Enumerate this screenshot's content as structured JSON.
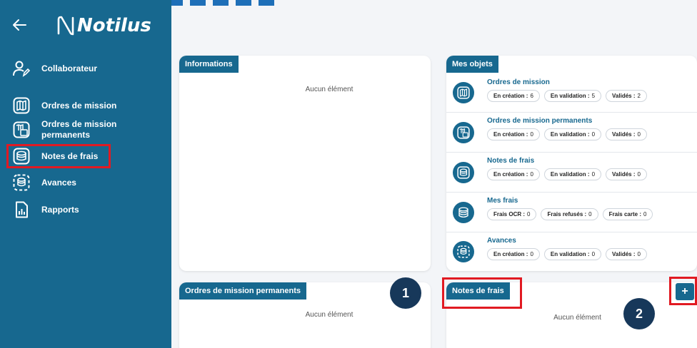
{
  "app": {
    "logo_text": "Notilus",
    "logo_symbol": "N"
  },
  "sidebar": {
    "back_icon": "arrow-left-icon",
    "items": [
      {
        "label": "Collaborateur",
        "icon": "user-edit-icon"
      },
      {
        "label": "Ordres de mission",
        "icon": "map-icon"
      },
      {
        "label": "Ordres de mission\npermanents",
        "icon": "map-calendar-icon"
      },
      {
        "label": "Notes de frais",
        "icon": "coins-icon"
      },
      {
        "label": "Avances",
        "icon": "coins-dashed-icon"
      },
      {
        "label": "Rapports",
        "icon": "report-chart-icon"
      }
    ]
  },
  "cards": {
    "informations": {
      "title": "Informations",
      "empty": "Aucun élément"
    },
    "ordres_permanents": {
      "title": "Ordres de mission permanents",
      "empty": "Aucun élément"
    },
    "notes_de_frais": {
      "title": "Notes de frais",
      "empty": "Aucun élément",
      "add_label": "+"
    }
  },
  "mes_objets": {
    "title": "Mes objets",
    "rows": [
      {
        "title": "Ordres de mission",
        "icon": "map-icon",
        "pills": [
          {
            "label": "En création :",
            "value": "6"
          },
          {
            "label": "En validation :",
            "value": "5"
          },
          {
            "label": "Validés :",
            "value": "2"
          }
        ]
      },
      {
        "title": "Ordres de mission permanents",
        "icon": "map-calendar-icon",
        "pills": [
          {
            "label": "En création :",
            "value": "0"
          },
          {
            "label": "En validation :",
            "value": "0"
          },
          {
            "label": "Validés :",
            "value": "0"
          }
        ]
      },
      {
        "title": "Notes de frais",
        "icon": "coins-icon",
        "pills": [
          {
            "label": "En création :",
            "value": "0"
          },
          {
            "label": "En validation :",
            "value": "0"
          },
          {
            "label": "Validés :",
            "value": "0"
          }
        ]
      },
      {
        "title": "Mes frais",
        "icon": "coins-stack-icon",
        "pills": [
          {
            "label": "Frais OCR :",
            "value": "0"
          },
          {
            "label": "Frais refusés :",
            "value": "0"
          },
          {
            "label": "Frais carte :",
            "value": "0"
          }
        ]
      },
      {
        "title": "Avances",
        "icon": "coins-dashed-icon",
        "pills": [
          {
            "label": "En création :",
            "value": "0"
          },
          {
            "label": "En validation :",
            "value": "0"
          },
          {
            "label": "Validés :",
            "value": "0"
          }
        ]
      }
    ]
  },
  "annotations": {
    "callout_1": "1",
    "callout_2": "2"
  },
  "colors": {
    "sidebar": "#17688f",
    "accent": "#17688f",
    "highlight": "#e11a22",
    "callout": "#17385a"
  }
}
